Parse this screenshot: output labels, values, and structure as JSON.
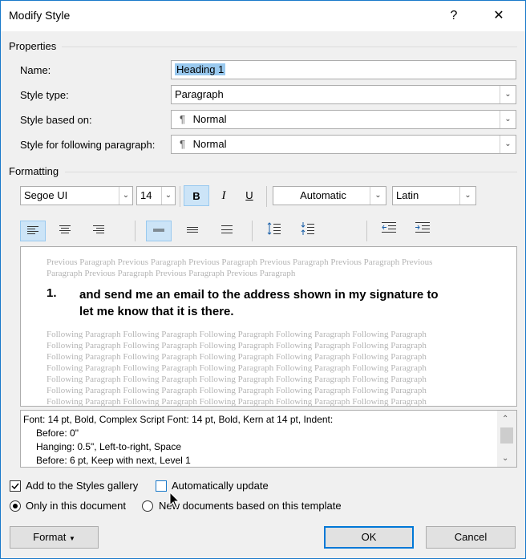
{
  "window": {
    "title": "Modify Style",
    "help_label": "?",
    "close_label": "✕"
  },
  "properties": {
    "section_label": "Properties",
    "name_label": "Name:",
    "name_value": "Heading 1",
    "style_type_label": "Style type:",
    "style_type_value": "Paragraph",
    "based_on_label": "Style based on:",
    "based_on_value": "Normal",
    "following_label": "Style for following paragraph:",
    "following_value": "Normal",
    "pilcrow": "¶"
  },
  "formatting": {
    "section_label": "Formatting",
    "font": "Segoe UI",
    "size": "14",
    "bold": "B",
    "italic": "I",
    "underline": "U",
    "color": "Automatic",
    "script": "Latin",
    "bold_active": true
  },
  "preview": {
    "previous_text": "Previous Paragraph Previous Paragraph Previous Paragraph Previous Paragraph Previous Paragraph Previous Paragraph Previous Paragraph Previous Paragraph Previous Paragraph",
    "number": "1.",
    "heading_line1": "and send me an email to the address shown in my signature to",
    "heading_line2": "let me know that it is there.",
    "following_text": "Following Paragraph Following Paragraph Following Paragraph Following Paragraph Following Paragraph"
  },
  "description": {
    "lines": [
      "Font: 14 pt, Bold, Complex Script Font: 14 pt, Bold, Kern at 14 pt, Indent:",
      "Before:  0\"",
      "Hanging:  0.5\", Left-to-right, Space",
      "Before:  6 pt, Keep with next, Level 1"
    ]
  },
  "options": {
    "add_to_gallery_label": "Add to the Styles gallery",
    "add_to_gallery_checked": true,
    "auto_update_label": "Automatically update",
    "auto_update_checked": false,
    "only_this_doc_label": "Only in this document",
    "new_docs_label": "New documents based on this template",
    "selected_scope": "only_this_doc"
  },
  "buttons": {
    "format_label": "Format",
    "ok_label": "OK",
    "cancel_label": "Cancel"
  }
}
